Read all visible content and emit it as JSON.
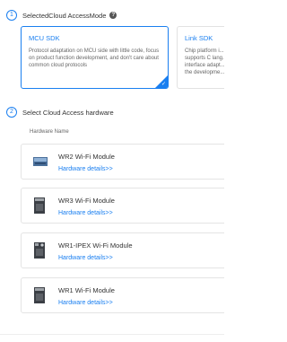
{
  "step1": {
    "number": "1",
    "title": "SelectedCloud AccessMode",
    "help_icon": "question-circle-icon"
  },
  "modes": [
    {
      "title": "MCU SDK",
      "description": "Protocol adaptation on MCU side with little code, focus on product function development, and don't care about common cloud protocols",
      "selected": true
    },
    {
      "title": "Link SDK",
      "description": "Chip platform i... supports C lang... interface adapt... the developme...",
      "selected": false
    }
  ],
  "step2": {
    "number": "2",
    "title": "Select Cloud Access hardware"
  },
  "hardware_header": "Hardware Name",
  "hardware": [
    {
      "name": "WR2 Wi-Fi Module",
      "link": "Hardware details>>",
      "icon": "wifi-module-board-icon"
    },
    {
      "name": "WR3 Wi-Fi Module",
      "link": "Hardware details>>",
      "icon": "wifi-module-chip-icon"
    },
    {
      "name": "WR1-IPEX Wi-Fi Module",
      "link": "Hardware details>>",
      "icon": "wifi-module-ipex-icon"
    },
    {
      "name": "WR1 Wi-Fi Module",
      "link": "Hardware details>>",
      "icon": "wifi-module-chip-icon"
    }
  ],
  "colors": {
    "accent": "#1a7ff0",
    "border": "#e4e4e4",
    "text": "#333333",
    "muted": "#666666"
  }
}
